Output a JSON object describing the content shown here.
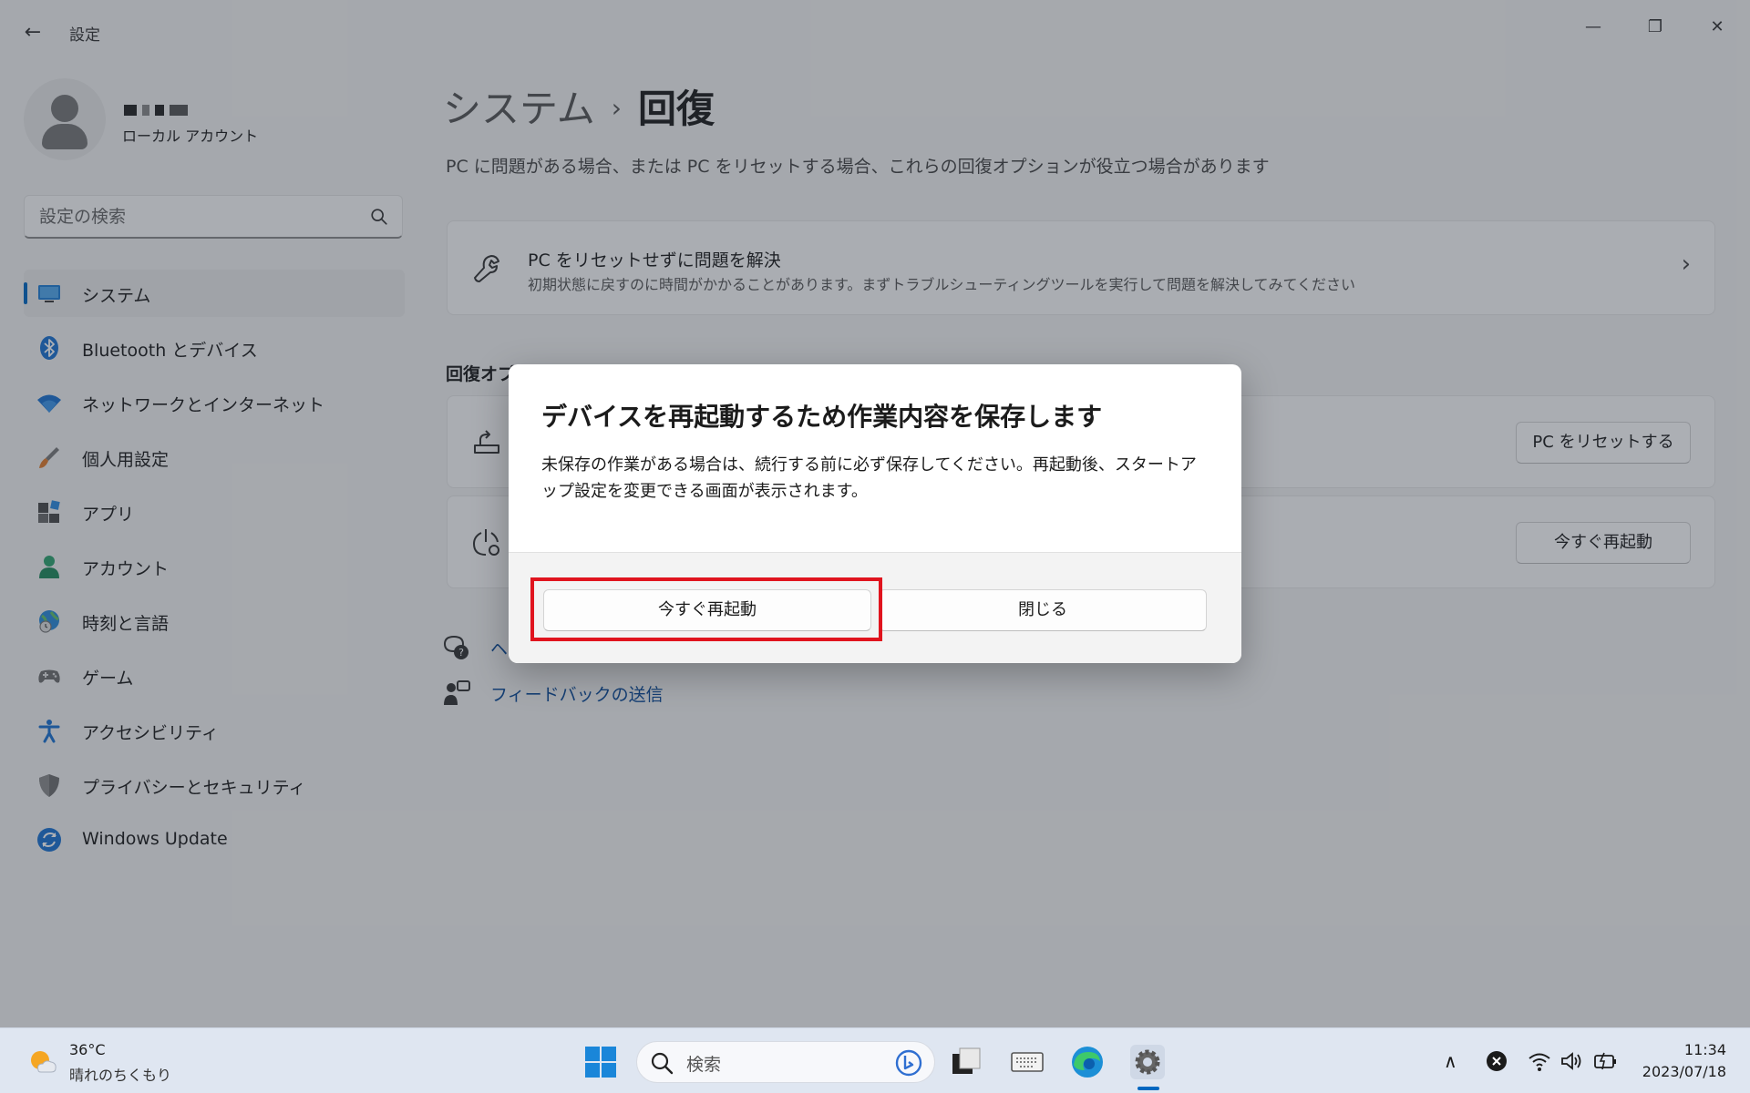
{
  "window": {
    "title": "設定",
    "back_symbol": "←",
    "minimize_symbol": "—",
    "maximize_symbol": "❐",
    "close_symbol": "✕"
  },
  "user": {
    "account_type": "ローカル アカウント"
  },
  "search": {
    "placeholder": "設定の検索"
  },
  "sidebar": {
    "items": [
      {
        "label": "システム",
        "icon": "system-display-icon"
      },
      {
        "label": "Bluetooth とデバイス",
        "icon": "bluetooth-icon"
      },
      {
        "label": "ネットワークとインターネット",
        "icon": "wifi-icon"
      },
      {
        "label": "個人用設定",
        "icon": "paintbrush-icon"
      },
      {
        "label": "アプリ",
        "icon": "apps-icon"
      },
      {
        "label": "アカウント",
        "icon": "account-icon"
      },
      {
        "label": "時刻と言語",
        "icon": "time-language-icon"
      },
      {
        "label": "ゲーム",
        "icon": "gamepad-icon"
      },
      {
        "label": "アクセシビリティ",
        "icon": "accessibility-icon"
      },
      {
        "label": "プライバシーとセキュリティ",
        "icon": "shield-icon"
      },
      {
        "label": "Windows Update",
        "icon": "windows-update-icon"
      }
    ],
    "active_index": 0
  },
  "main": {
    "breadcrumb_parent": "システム",
    "breadcrumb_separator": "›",
    "breadcrumb_current": "回復",
    "description": "PC に問題がある場合、または PC をリセットする場合、これらの回復オプションが役立つ場合があります",
    "troubleshoot_card": {
      "title": "PC をリセットせずに問題を解決",
      "subtitle": "初期状態に戻すのに時間がかかることがあります。まずトラブルシューティングツールを実行して問題を解決してみてください",
      "chevron": "›"
    },
    "section_title": "回復オプ",
    "reset_button": "PC をリセットする",
    "restart_now_button": "今すぐ再起動",
    "help_link": "ヘ",
    "feedback_link": "フィードバックの送信"
  },
  "dialog": {
    "title": "デバイスを再起動するため作業内容を保存します",
    "body": "未保存の作業がある場合は、続行する前に必ず保存してください。再起動後、スタートアップ設定を変更できる画面が表示されます。",
    "primary_button": "今すぐ再起動",
    "secondary_button": "閉じる"
  },
  "taskbar": {
    "weather_temp": "36°C",
    "weather_desc": "晴れのちくもり",
    "search_placeholder": "検索",
    "time": "11:34",
    "date": "2023/07/18",
    "tray_chevron": "∧"
  },
  "colors": {
    "accent": "#0067c0",
    "highlight_border": "#e0141e",
    "link": "#0b4a96"
  }
}
